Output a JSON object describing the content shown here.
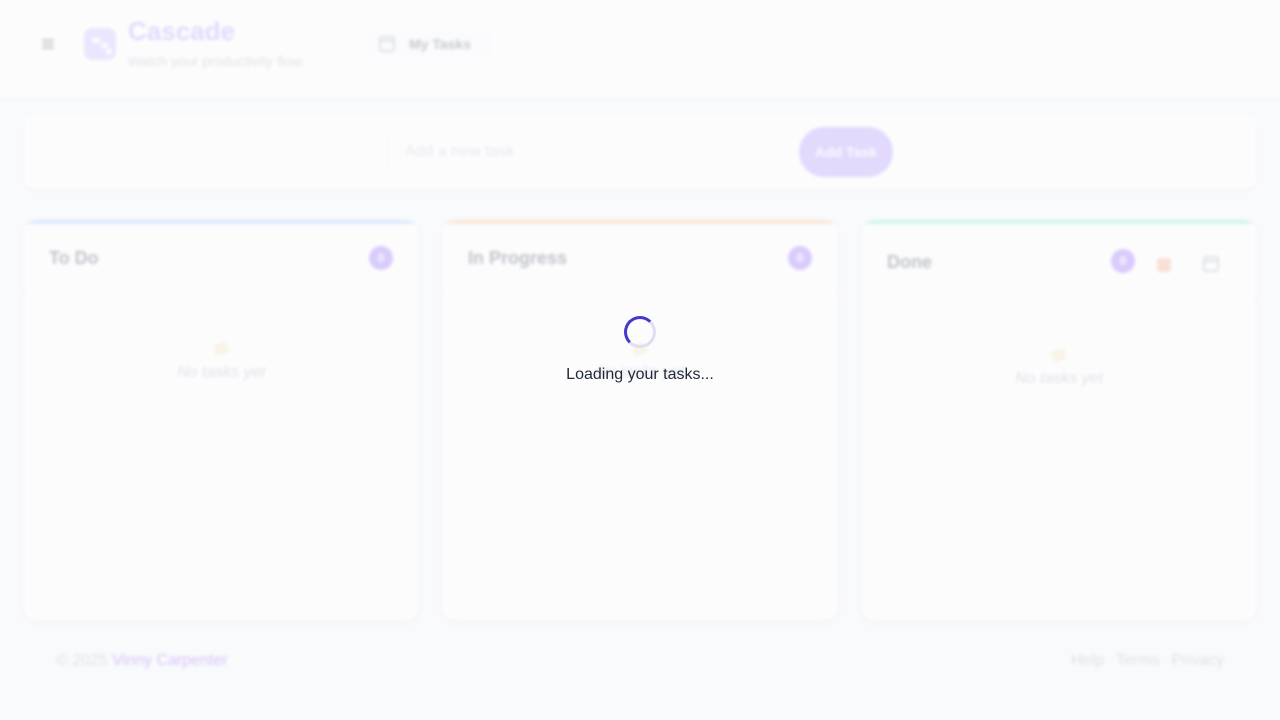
{
  "header": {
    "menu_icon": "hamburger-icon",
    "logo_icon": "kanban-logo-icon",
    "title": "Cascade",
    "subtitle": "Watch your productivity flow.",
    "tab_icon": "calendar-icon",
    "tab_label": "My Tasks"
  },
  "add_task": {
    "placeholder": "Add a new task",
    "value": "",
    "button_label": "Add Task"
  },
  "columns": [
    {
      "title": "To Do",
      "count": "0",
      "empty_icon": "memo-icon",
      "empty_text": "No tasks yet",
      "accent": "#93c5fd"
    },
    {
      "title": "In Progress",
      "count": "0",
      "empty_icon": "memo-icon",
      "empty_text": "No tasks yet",
      "accent": "#fdba74"
    },
    {
      "title": "Done",
      "count": "0",
      "empty_icon": "memo-icon",
      "empty_text": "No tasks yet",
      "accent": "#6ee7b7",
      "extra_icons": [
        "box-icon",
        "calendar-icon"
      ]
    }
  ],
  "footer": {
    "copyright_prefix": "© 2025",
    "author": "Vinny Carpenter",
    "links": [
      "Help",
      "Terms",
      "Privacy"
    ]
  },
  "loading": {
    "text": "Loading your tasks...",
    "spinner_icon": "spinner-icon"
  },
  "colors": {
    "brand": "#a78bfa",
    "count_badge": "#8b5cf6",
    "spinner": "#4338ca"
  }
}
